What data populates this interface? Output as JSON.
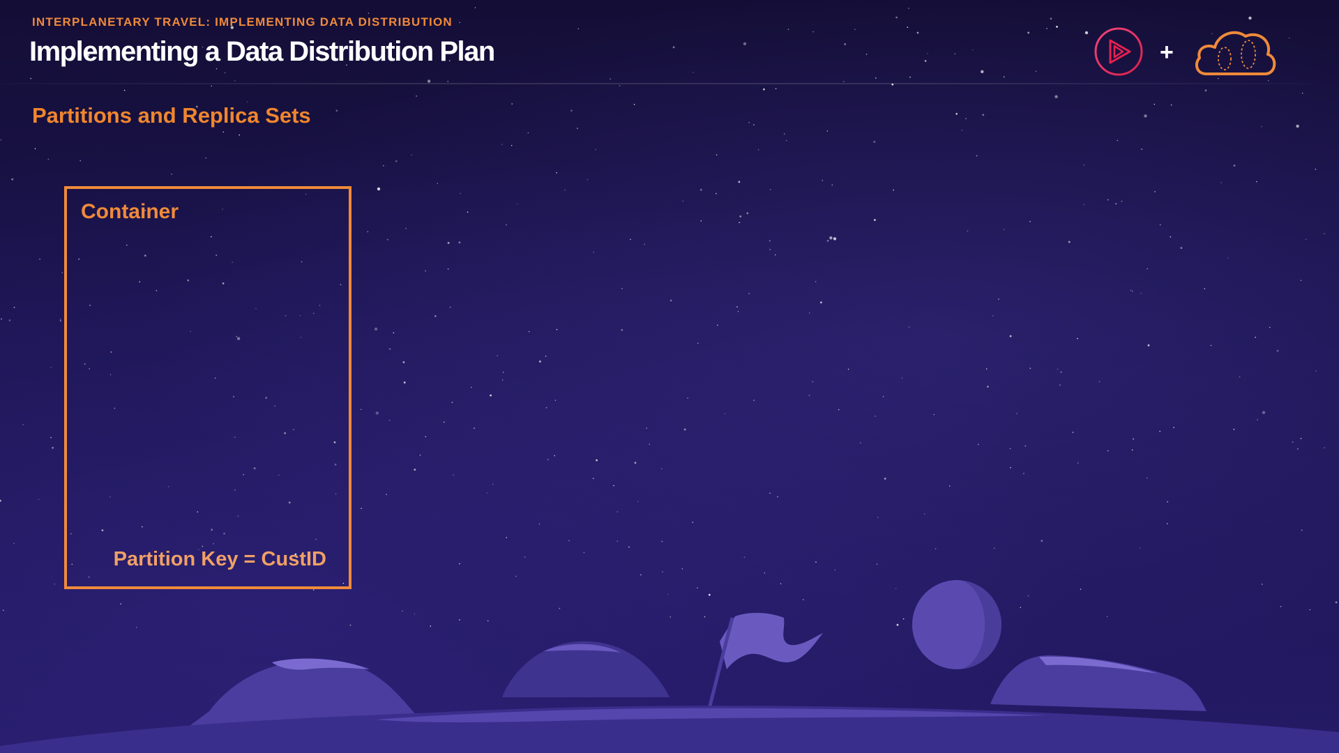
{
  "header": {
    "eyebrow": "INTERPLANETARY TRAVEL: IMPLEMENTING DATA DISTRIBUTION",
    "title": "Implementing a Data Distribution Plan",
    "plus_symbol": "+",
    "logos": [
      "play-logo-icon",
      "cloud-logo-icon"
    ]
  },
  "section": {
    "subtitle": "Partitions and Replica Sets"
  },
  "container": {
    "label": "Container",
    "partition_key": "Partition Key = CustID"
  },
  "colors": {
    "accent_orange": "#f08a3a",
    "logo_red": "#e8214f",
    "background": "#1b1450",
    "title_white": "#ffffff"
  }
}
